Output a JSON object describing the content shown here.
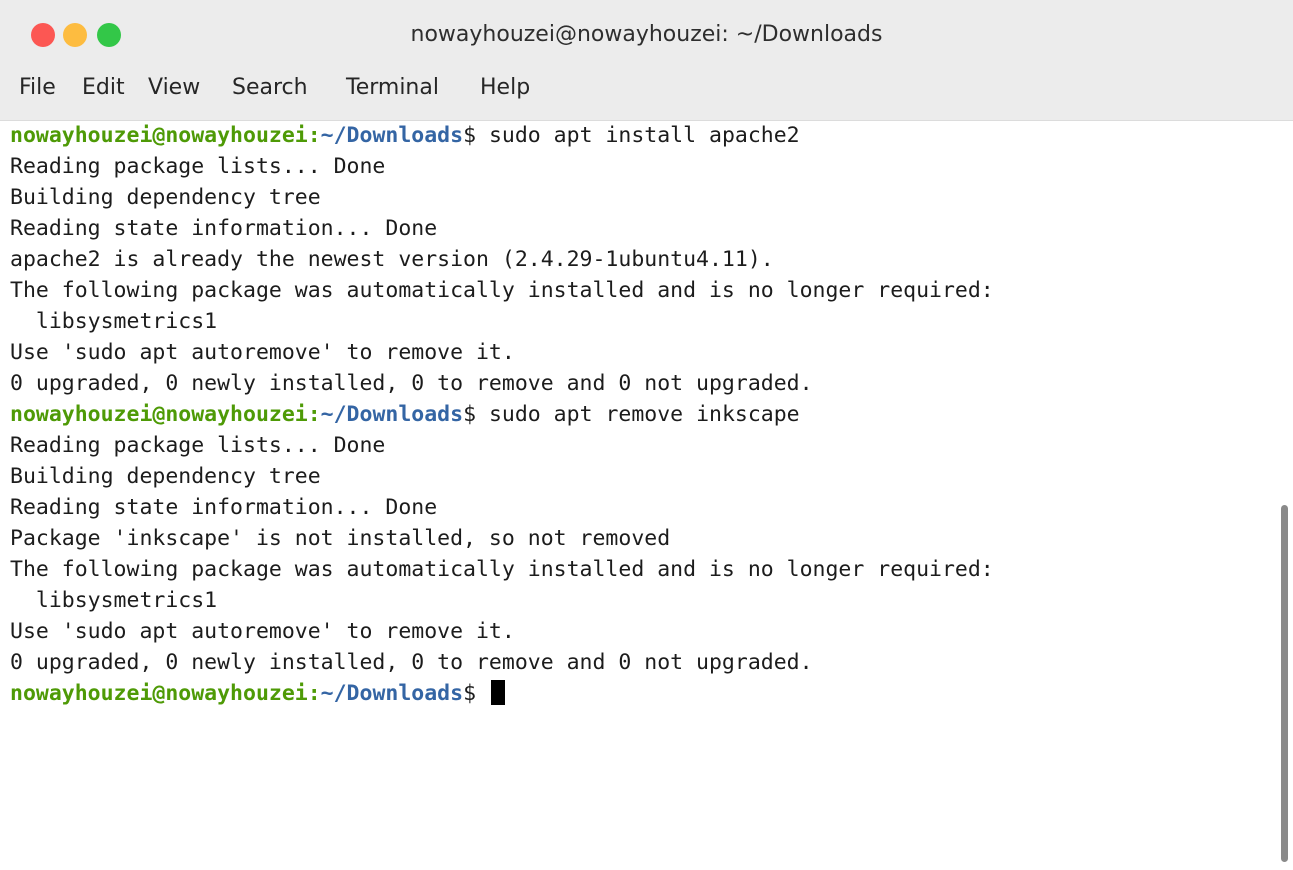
{
  "window": {
    "title": "nowayhouzei@nowayhouzei: ~/Downloads"
  },
  "menu": [
    "File",
    "Edit",
    "View",
    "Search",
    "Terminal",
    "Help"
  ],
  "prompt": {
    "user": "nowayhouzei@nowayhouzei",
    "sep": ":",
    "path": "~/Downloads",
    "sym": "$"
  },
  "lines": [
    " sudo apt install apache2",
    "Reading package lists... Done",
    "Building dependency tree",
    "Reading state information... Done",
    "apache2 is already the newest version (2.4.29-1ubuntu4.11).",
    "The following package was automatically installed and is no longer required:",
    "  libsysmetrics1",
    "Use 'sudo apt autoremove' to remove it.",
    "0 upgraded, 0 newly installed, 0 to remove and 0 not upgraded.",
    " sudo apt remove inkscape",
    "Reading package lists... Done",
    "Building dependency tree",
    "Reading state information... Done",
    "Package 'inkscape' is not installed, so not removed",
    "The following package was automatically installed and is no longer required:",
    "  libsysmetrics1",
    "Use 'sudo apt autoremove' to remove it.",
    "0 upgraded, 0 newly installed, 0 to remove and 0 not upgraded.",
    " "
  ]
}
